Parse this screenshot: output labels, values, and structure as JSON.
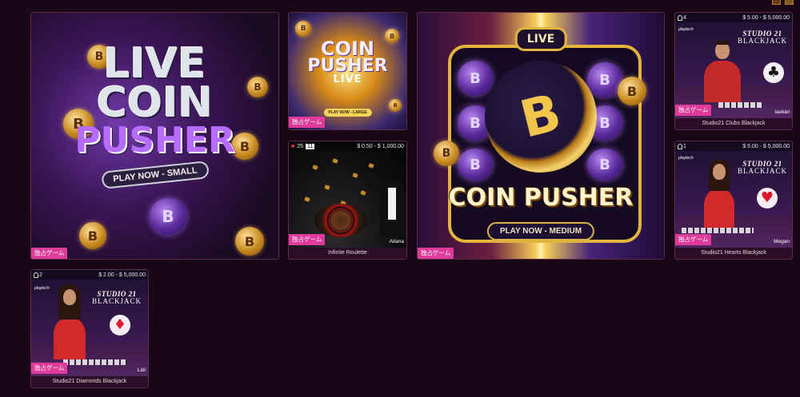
{
  "colors": {
    "background": "#1a0716",
    "badge": "#e03a9a",
    "tile_border": "#5a2a4f",
    "caption_bg": "#2b0d26"
  },
  "badge_label": "独占ゲーム",
  "tiles": {
    "coin_small": {
      "art_text": {
        "line1": "LIVE",
        "line2": "COIN",
        "line3": "PUSHER",
        "play": "PLAY NOW - SMALL"
      },
      "badge": "独占ゲーム"
    },
    "coin_large": {
      "art_text": {
        "line1": "COIN",
        "line2": "PUSHER",
        "line3": "LIVE",
        "play": "PLAY NOW - LARGE"
      },
      "badge": "独占ゲーム"
    },
    "roulette": {
      "history": [
        "25",
        "11"
      ],
      "bet_range": "$ 0.50 - $ 1,000.00",
      "dealer": "Aitana",
      "caption": "Infinite Roulette",
      "badge": "独占ゲーム"
    },
    "coin_medium": {
      "art_text": {
        "live": "LIVE",
        "title": "COIN PUSHER",
        "play": "PLAY NOW - MEDIUM"
      },
      "badge": "独占ゲーム"
    },
    "clubs": {
      "seats": "4",
      "bet_range": "$ 5.00 - $ 5,000.00",
      "sign_line1": "STUDIO 21",
      "sign_line2": "BLACKJACK",
      "suit_icon": "♣",
      "dealer": "Iaekiel",
      "caption": "Studio21 Clubs Blackjack",
      "badge": "独占ゲーム"
    },
    "hearts": {
      "seats": "1",
      "bet_range": "$ 5.00 - $ 5,000.00",
      "sign_line1": "STUDIO 21",
      "sign_line2": "BLACKJACK",
      "suit_icon": "♥",
      "dealer": "Megan",
      "caption": "Studio21 Hearts Blackjack",
      "badge": "独占ゲーム"
    },
    "diamonds": {
      "seats": "2",
      "bet_range": "$ 2.00 - $ 5,000.00",
      "sign_line1": "STUDIO 21",
      "sign_line2": "BLACKJACK",
      "suit_icon": "♦",
      "dealer": "Lidi",
      "caption": "Studio21 Diamonds Blackjack",
      "badge": "独占ゲーム"
    }
  }
}
